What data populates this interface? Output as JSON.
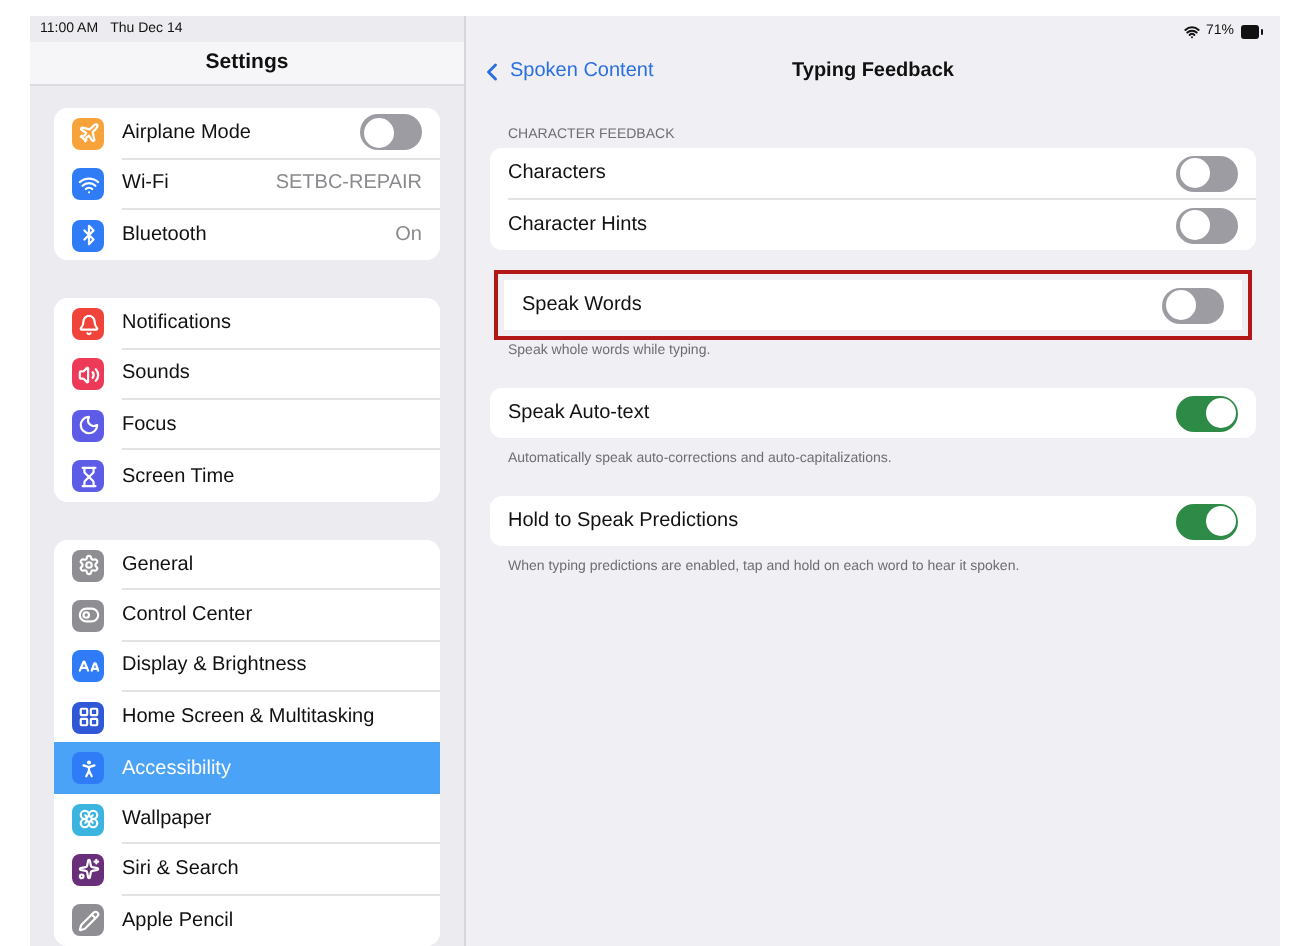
{
  "status_bar": {
    "time": "11:00 AM",
    "date": "Thu Dec 14",
    "battery": "71%"
  },
  "sidebar": {
    "title": "Settings",
    "groups": [
      {
        "items": [
          {
            "kind": "airplane",
            "label": "Airplane Mode",
            "on": false,
            "selected": false
          },
          {
            "kind": "wifi",
            "label": "Wi-Fi",
            "value": "SETBC-REPAIR",
            "selected": false
          },
          {
            "kind": "bluetooth",
            "label": "Bluetooth",
            "value": "On",
            "selected": false
          }
        ]
      },
      {
        "items": [
          {
            "kind": "notifications",
            "label": "Notifications",
            "selected": false
          },
          {
            "kind": "sounds",
            "label": "Sounds",
            "selected": false
          },
          {
            "kind": "focus",
            "label": "Focus",
            "selected": false
          },
          {
            "kind": "screentime",
            "label": "Screen Time",
            "selected": false
          }
        ]
      },
      {
        "items": [
          {
            "kind": "general",
            "label": "General",
            "selected": false
          },
          {
            "kind": "controlcenter",
            "label": "Control Center",
            "selected": false
          },
          {
            "kind": "display",
            "label": "Display & Brightness",
            "selected": false
          },
          {
            "kind": "homescreen",
            "label": "Home Screen & Multitasking",
            "selected": false
          },
          {
            "kind": "accessibility",
            "label": "Accessibility",
            "selected": true
          },
          {
            "kind": "wallpaper",
            "label": "Wallpaper",
            "selected": false
          },
          {
            "kind": "siri",
            "label": "Siri & Search",
            "selected": false
          },
          {
            "kind": "pencil",
            "label": "Apple Pencil",
            "selected": false
          }
        ]
      }
    ]
  },
  "detail": {
    "back": "Spoken Content",
    "title": "Typing Feedback",
    "groups": [
      {
        "header": "CHARACTER FEEDBACK",
        "highlighted": false,
        "rows": [
          {
            "label": "Characters",
            "on": false
          },
          {
            "label": "Character Hints",
            "on": false
          }
        ]
      },
      {
        "highlighted": true,
        "rows": [
          {
            "label": "Speak Words",
            "on": false
          }
        ],
        "footer": "Speak whole words while typing."
      },
      {
        "highlighted": false,
        "rows": [
          {
            "label": "Speak Auto-text",
            "on": true
          }
        ],
        "footer": "Automatically speak auto-corrections and auto-capitalizations."
      },
      {
        "highlighted": false,
        "rows": [
          {
            "label": "Hold to Speak Predictions",
            "on": true
          }
        ],
        "footer": "When typing predictions are enabled, tap and hold on each word to hear it spoken."
      }
    ]
  }
}
